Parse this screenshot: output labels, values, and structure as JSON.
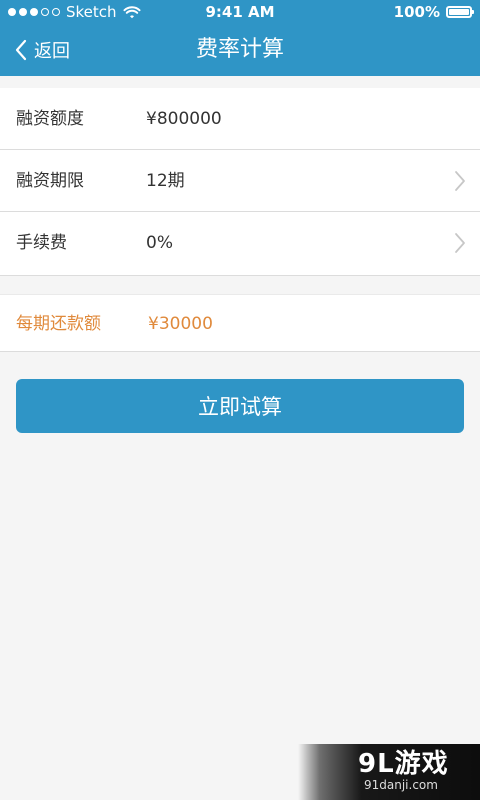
{
  "status_bar": {
    "carrier": "Sketch",
    "time": "9:41 AM",
    "battery": "100%"
  },
  "nav": {
    "back_label": "返回",
    "title": "费率计算"
  },
  "form": {
    "rows": [
      {
        "label": "融资额度",
        "value": "¥800000"
      },
      {
        "label": "融资期限",
        "value": "12期"
      },
      {
        "label": "手续费",
        "value": "0%"
      }
    ]
  },
  "result": {
    "label": "每期还款额",
    "value": "¥30000"
  },
  "actions": {
    "calculate_label": "立即试算"
  },
  "watermark": {
    "main": "9L游戏",
    "sub": "91danji.com"
  },
  "colors": {
    "primary": "#2f95c6",
    "accent": "#e08a3c"
  },
  "icons": {
    "back": "chevron-left-icon",
    "chevron": "chevron-right-icon"
  }
}
